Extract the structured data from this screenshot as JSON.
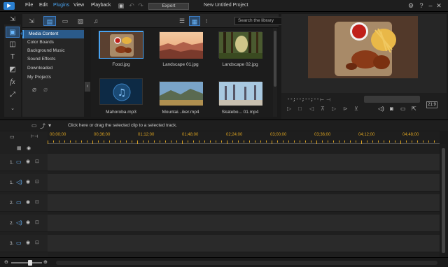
{
  "menubar": {
    "items": [
      "File",
      "Edit",
      "Plugins",
      "View",
      "Playback"
    ],
    "active": "Plugins",
    "export_label": "Export",
    "project_title": "New Untitled Project"
  },
  "room_tabs": {
    "search_placeholder": "Search the library"
  },
  "categories": [
    "Media Content",
    "Color Boards",
    "Background Music",
    "Sound Effects",
    "Downloaded",
    "My Projects"
  ],
  "selected_category": "Media Content",
  "library": [
    {
      "name": "Food.jpg",
      "kind": "food",
      "selected": true
    },
    {
      "name": "Landscape 01.jpg",
      "kind": "canyon",
      "selected": false
    },
    {
      "name": "Landscape 02.jpg",
      "kind": "forest",
      "selected": false
    },
    {
      "name": "Mahoroba.mp3",
      "kind": "music",
      "selected": false
    },
    {
      "name": "Mountai...iker.mp4",
      "kind": "mountain",
      "selected": false
    },
    {
      "name": "Skatebo... 01.mp4",
      "kind": "skate",
      "selected": false
    }
  ],
  "preview": {
    "timecode": "--;--;--;--",
    "aspect": "21:9"
  },
  "timeline": {
    "hint": "Click here or drag the selected clip to a selected track.",
    "ruler": [
      "00;00;00",
      "00;36;00",
      "01;12;00",
      "01;48;00",
      "02;24;00",
      "03;00;00",
      "03;36;00",
      "04;12;00",
      "04;48;00"
    ],
    "tracks": [
      {
        "num": "1.",
        "type": "video"
      },
      {
        "num": "1.",
        "type": "audio"
      },
      {
        "num": "2.",
        "type": "video"
      },
      {
        "num": "2.",
        "type": "audio"
      },
      {
        "num": "3.",
        "type": "video"
      }
    ]
  },
  "colors": {
    "accent": "#4aa3f0",
    "ruler": "#d8a020"
  }
}
